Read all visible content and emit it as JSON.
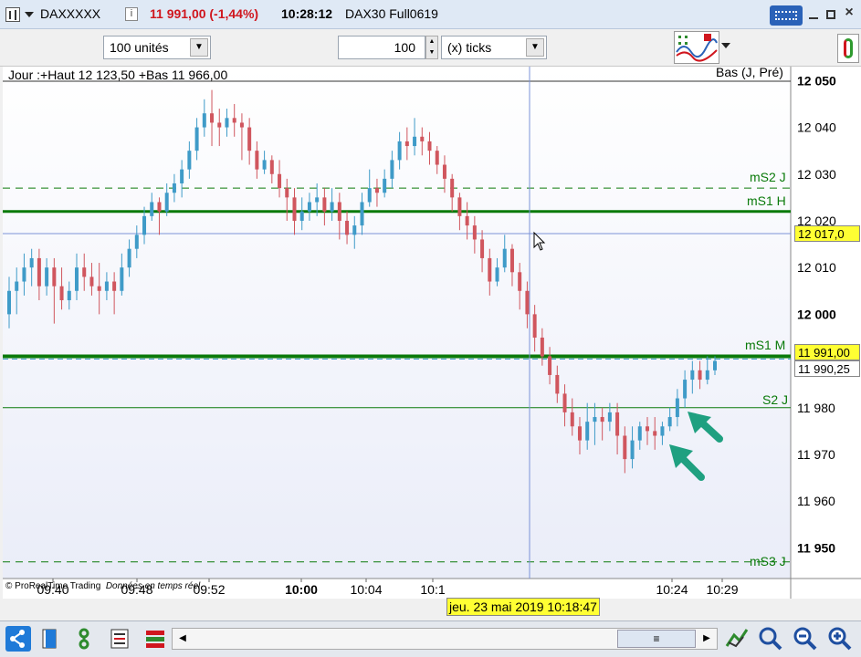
{
  "titlebar": {
    "instrument": "DAXXXXX",
    "price_change": "11 991,00 (-1,44%)",
    "time": "10:28:12",
    "contract": "DAX30 Full0619",
    "info_icon": "i"
  },
  "toolbar": {
    "quantity": "100 unités",
    "ticks_value": "100",
    "ticks_unit": "(x) ticks"
  },
  "chart": {
    "header": "Jour :+Haut 12 123,50 +Bas 11 966,00",
    "header_right": "Bas (J, Pré)",
    "copyright": "© ProRealTime Trading",
    "realtime": "Données en temps réel",
    "line_labels": {
      "ms2j": "mS2 J",
      "ms1h": "mS1 H",
      "ms1m": "mS1 M",
      "s2j": "S2 J",
      "ms3j": "mS3 J"
    },
    "y_ticks": [
      "12 050",
      "12 040",
      "12 030",
      "12 020",
      "12 010",
      "12 000",
      "11 980",
      "11 970",
      "11 960",
      "11 950"
    ],
    "y_tick_bold": [
      "12 050",
      "12 000",
      "11 950"
    ],
    "cursor_price": "12 017,0",
    "last_price": "11 991,00",
    "bid_price": "11 990,25",
    "x_ticks": [
      "09:40",
      "09:48",
      "09:52",
      "10:00",
      "10:04",
      "10:1",
      "10:24",
      "10:29"
    ],
    "crosshair_date": "jeu. 23 mai 2019 10:18:47",
    "colors": {
      "up": "#3f9bc8",
      "down": "#d0565e",
      "level": "#0a7a0a",
      "arrow": "#1fa080",
      "yellowbox": "#ffff33"
    }
  },
  "chart_data": {
    "type": "candlestick",
    "ylim": [
      11945,
      12053
    ],
    "levels": {
      "mS2 J": 12027,
      "mS1 H": 12022,
      "mS1 M": 11991,
      "S2 J": 11980,
      "mS3 J": 11947
    },
    "candles": [
      [
        12000,
        12005,
        11997,
        12008
      ],
      [
        12005,
        12007,
        12000,
        12010
      ],
      [
        12007,
        12010,
        12004,
        12013
      ],
      [
        12010,
        12012,
        12006,
        12014
      ],
      [
        12012,
        12006,
        12003,
        12014
      ],
      [
        12006,
        12010,
        12004,
        12012
      ],
      [
        12010,
        12006,
        11998,
        12012
      ],
      [
        12006,
        12003,
        12001,
        12010
      ],
      [
        12003,
        12005,
        12001,
        12007
      ],
      [
        12005,
        12010,
        12003,
        12013
      ],
      [
        12010,
        12008,
        12005,
        12013
      ],
      [
        12008,
        12006,
        12004,
        12011
      ],
      [
        12006,
        12005,
        12000,
        12011
      ],
      [
        12005,
        12007,
        12003,
        12009
      ],
      [
        12007,
        12005,
        12000,
        12009
      ],
      [
        12005,
        12010,
        12004,
        12013
      ],
      [
        12010,
        12014,
        12008,
        12016
      ],
      [
        12014,
        12017,
        12012,
        12019
      ],
      [
        12017,
        12021,
        12015,
        12023
      ],
      [
        12021,
        12024,
        12020,
        12026
      ],
      [
        12024,
        12022,
        12017,
        12025
      ],
      [
        12022,
        12026,
        12021,
        12028
      ],
      [
        12026,
        12028,
        12024,
        12030
      ],
      [
        12028,
        12031,
        12025,
        12033
      ],
      [
        12031,
        12035,
        12029,
        12037
      ],
      [
        12035,
        12040,
        12033,
        12042
      ],
      [
        12040,
        12043,
        12038,
        12046
      ],
      [
        12043,
        12041,
        12036,
        12048
      ],
      [
        12041,
        12040,
        12036,
        12044
      ],
      [
        12040,
        12042,
        12038,
        12044
      ],
      [
        12042,
        12041,
        12038,
        12045
      ],
      [
        12041,
        12040,
        12033,
        12043
      ],
      [
        12040,
        12035,
        12032,
        12042
      ],
      [
        12035,
        12031,
        12029,
        12037
      ],
      [
        12031,
        12033,
        12030,
        12035
      ],
      [
        12033,
        12030,
        12028,
        12034
      ],
      [
        12030,
        12027,
        12025,
        12033
      ],
      [
        12027,
        12025,
        12020,
        12029
      ],
      [
        12025,
        12020,
        12017,
        12027
      ],
      [
        12020,
        12022,
        12018,
        12025
      ],
      [
        12022,
        12024,
        12020,
        12026
      ],
      [
        12024,
        12025,
        12021,
        12028
      ],
      [
        12025,
        12022,
        12019,
        12027
      ],
      [
        12022,
        12024,
        12020,
        12027
      ],
      [
        12024,
        12020,
        12016,
        12026
      ],
      [
        12020,
        12017,
        12015,
        12022
      ],
      [
        12017,
        12019,
        12014,
        12021
      ],
      [
        12019,
        12024,
        12017,
        12026
      ],
      [
        12024,
        12027,
        12023,
        12031
      ],
      [
        12027,
        12026,
        12023,
        12029
      ],
      [
        12026,
        12029,
        12025,
        12031
      ],
      [
        12029,
        12033,
        12027,
        12035
      ],
      [
        12033,
        12037,
        12031,
        12039
      ],
      [
        12037,
        12036,
        12033,
        12040
      ],
      [
        12036,
        12038,
        12034,
        12042
      ],
      [
        12038,
        12037,
        12034,
        12040
      ],
      [
        12037,
        12035,
        12032,
        12039
      ],
      [
        12035,
        12032,
        12030,
        12036
      ],
      [
        12032,
        12029,
        12026,
        12034
      ],
      [
        12029,
        12025,
        12022,
        12030
      ],
      [
        12025,
        12021,
        12018,
        12026
      ],
      [
        12021,
        12019,
        12016,
        12024
      ],
      [
        12019,
        12016,
        12013,
        12021
      ],
      [
        12016,
        12012,
        12009,
        12018
      ],
      [
        12012,
        12007,
        12004,
        12014
      ],
      [
        12007,
        12010,
        12006,
        12012
      ],
      [
        12010,
        12014,
        12009,
        12017
      ],
      [
        12014,
        12009,
        12006,
        12015
      ],
      [
        12009,
        12005,
        12001,
        12011
      ],
      [
        12005,
        12000,
        11997,
        12007
      ],
      [
        12000,
        11995,
        11992,
        12002
      ],
      [
        11995,
        11991,
        11989,
        11997
      ],
      [
        11991,
        11987,
        11985,
        11993
      ],
      [
        11987,
        11983,
        11981,
        11989
      ],
      [
        11983,
        11979,
        11976,
        11985
      ],
      [
        11979,
        11976,
        11974,
        11982
      ],
      [
        11976,
        11973,
        11970,
        11978
      ],
      [
        11973,
        11977,
        11971,
        11981
      ],
      [
        11977,
        11978,
        11972,
        11981
      ],
      [
        11978,
        11977,
        11973,
        11980
      ],
      [
        11977,
        11979,
        11975,
        11981
      ],
      [
        11979,
        11974,
        11970,
        11981
      ],
      [
        11974,
        11969,
        11966,
        11976
      ],
      [
        11969,
        11973,
        11967,
        11976
      ],
      [
        11973,
        11976,
        11971,
        11977
      ],
      [
        11976,
        11975,
        11972,
        11978
      ],
      [
        11975,
        11974,
        11971,
        11978
      ],
      [
        11974,
        11976,
        11972,
        11977
      ],
      [
        11976,
        11978,
        11975,
        11980
      ],
      [
        11978,
        11982,
        11976,
        11984
      ],
      [
        11982,
        11986,
        11980,
        11988
      ],
      [
        11986,
        11988,
        11983,
        11990
      ],
      [
        11988,
        11986,
        11984,
        11990
      ],
      [
        11986,
        11988,
        11985,
        11991
      ],
      [
        11988,
        11990,
        11987,
        11991
      ]
    ]
  },
  "bottombar": {
    "scroll_thumb": "≡"
  }
}
